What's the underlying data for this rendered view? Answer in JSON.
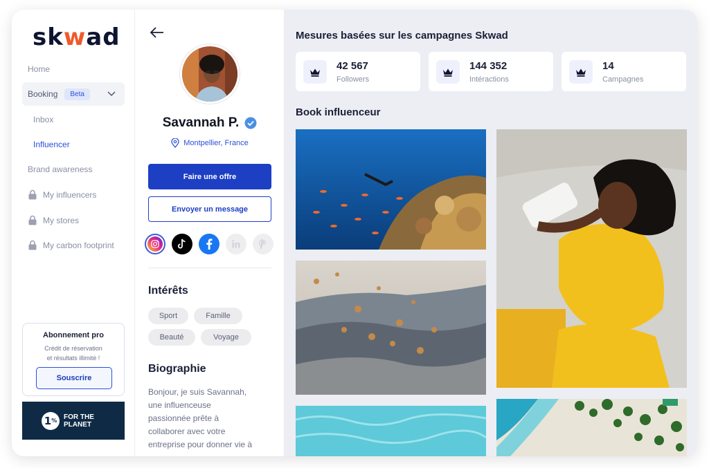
{
  "sidebar": {
    "logo": {
      "pre": "sk",
      "accent": "w",
      "post": "ad"
    },
    "home": "Home",
    "booking": "Booking",
    "beta": "Beta",
    "inbox": "Inbox",
    "influencer": "Influencer",
    "brand_awareness": "Brand awareness",
    "my_influencers": "My influencers",
    "my_stores": "My stores",
    "my_carbon": "My carbon footprint",
    "promo": {
      "title": "Abonnement pro",
      "line1": "Crédit de réservation",
      "line2": "et résultats illimité !",
      "button": "Souscrire"
    },
    "planet": {
      "num": "1",
      "pct": "%",
      "line1": "FOR THE",
      "line2": "PLANET"
    }
  },
  "profile": {
    "name": "Savannah P.",
    "location": "Montpellier, France",
    "offer_button": "Faire une offre",
    "message_button": "Envoyer un message",
    "interests_title": "Intérêts",
    "interests": [
      "Sport",
      "Famille",
      "Beauté",
      "Voyage"
    ],
    "bio_title": "Biographie",
    "bio_lines": [
      "Bonjour, je suis Savannah,",
      "une influenceuse",
      "passionnée prête à",
      "collaborer avec votre",
      "entreprise pour donner vie à"
    ]
  },
  "main": {
    "title": "Mesures basées sur les campagnes Skwad",
    "stats": [
      {
        "value": "42 567",
        "label": "Followers"
      },
      {
        "value": "144 352",
        "label": "Intéractions"
      },
      {
        "value": "14",
        "label": "Campagnes"
      }
    ],
    "book_title": "Book influenceur"
  },
  "colors": {
    "primary": "#1c3fc4",
    "accent": "#f0592a",
    "planet": "#0f2a45",
    "link": "#2c4fd8"
  }
}
